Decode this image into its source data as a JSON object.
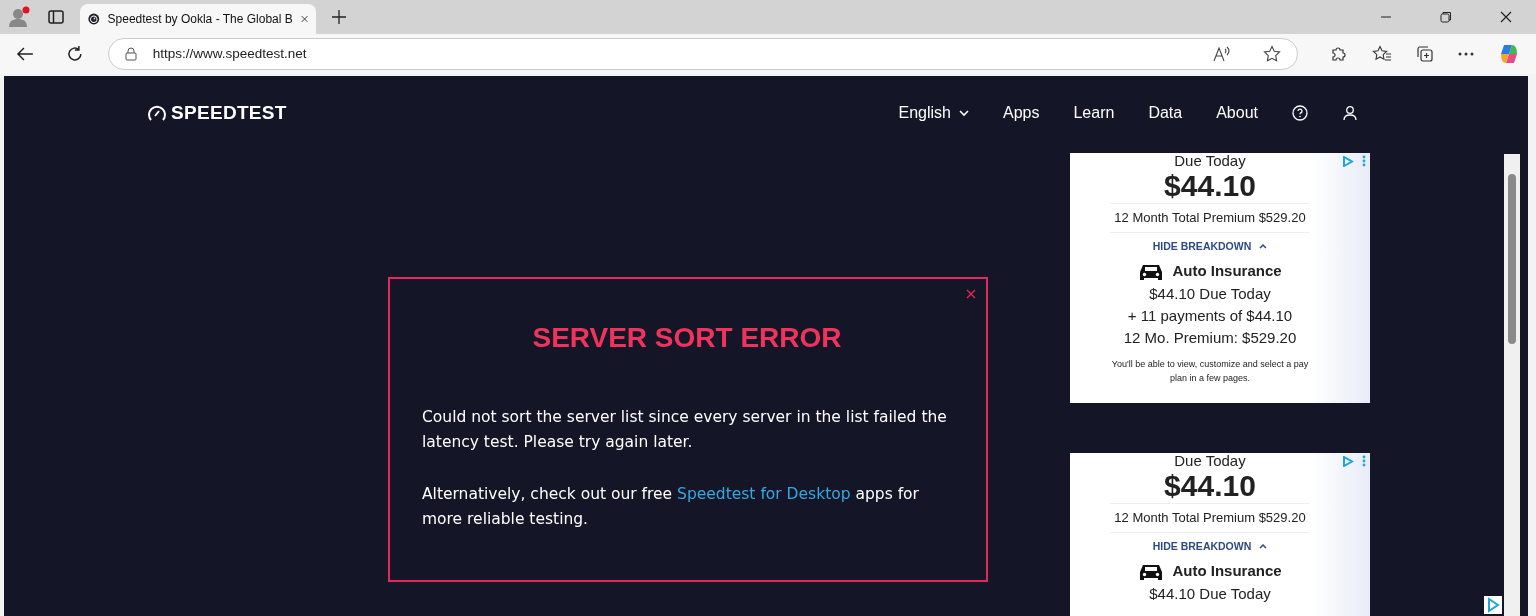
{
  "browser": {
    "tab_title": "Speedtest by Ookla - The Global B",
    "url": "https://www.speedtest.net"
  },
  "site": {
    "logo": "SPEEDTEST",
    "nav": [
      {
        "label": "English",
        "kind": "dropdown"
      },
      {
        "label": "Apps",
        "kind": "link"
      },
      {
        "label": "Learn",
        "kind": "link"
      },
      {
        "label": "Data",
        "kind": "link"
      },
      {
        "label": "About",
        "kind": "link"
      },
      {
        "kind": "help"
      },
      {
        "kind": "account"
      }
    ]
  },
  "modal": {
    "title": "SERVER SORT ERROR",
    "paragraphs": [
      {
        "before": "Could not sort the server list since every server in the list failed the latency test. Please try again later."
      },
      {
        "before": "Alternatively, check out our free ",
        "link": "Speedtest for Desktop",
        "after": " apps for more reliable testing."
      }
    ]
  },
  "ads": [
    {
      "due_label": "Due Today",
      "amount": "$44.10",
      "total": "12 Month Total Premium $529.20",
      "toggle": "HIDE BREAKDOWN",
      "product": "Auto Insurance",
      "lines": [
        "$44.10 Due Today",
        "+ 11 payments of $44.10",
        "12 Mo. Premium: $529.20"
      ],
      "note": "You'll be able to view, customize and select a pay plan in a few pages."
    },
    {
      "due_label": "Due Today",
      "amount": "$44.10",
      "total": "12 Month Total Premium $529.20",
      "toggle": "HIDE BREAKDOWN",
      "product": "Auto Insurance",
      "lines": [
        "$44.10 Due Today"
      ]
    }
  ]
}
